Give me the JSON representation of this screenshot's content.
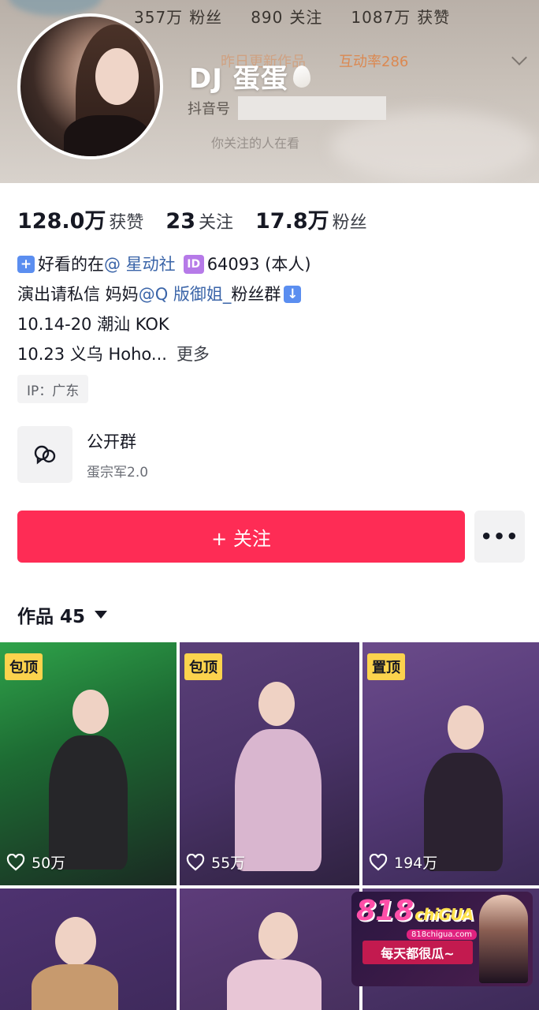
{
  "header": {
    "top_stats": [
      {
        "value": "357万",
        "label": "粉丝"
      },
      {
        "value": "890",
        "label": "关注"
      },
      {
        "value": "1087万",
        "label": "获赞"
      }
    ],
    "faint_line_1": "昨日更新作品",
    "faint_line_2": "互动率286",
    "name": "DJ 蛋蛋",
    "douyin_id_label": "抖音号",
    "faint_line_3": "你关注的人在看"
  },
  "stats": [
    {
      "value": "128.0万",
      "label": "获赞"
    },
    {
      "value": "23",
      "label": "关注"
    },
    {
      "value": "17.8万",
      "label": "粉丝"
    }
  ],
  "bio": {
    "line1_text": "好看的在",
    "line1_mention": "@ 星动社",
    "line1_id_badge": "ID",
    "line1_suffix": "64093 (本人)",
    "line2_text": "演出请私信  妈妈",
    "line2_mention": "@Q 版御姐_",
    "line2_suffix": " 粉丝群",
    "line3": "10.14-20 潮汕 KOK",
    "line4": "10.23 义乌 Hoho...",
    "more": "更多"
  },
  "ip_tag": "IP：广东",
  "group": {
    "title": "公开群",
    "subtitle": "蛋宗军2.0"
  },
  "follow_button": "+ 关注",
  "more_button": "•••",
  "works_tab": "作品 45",
  "tiles": [
    {
      "badge": "包顶",
      "likes": "50万"
    },
    {
      "badge": "包顶",
      "likes": "55万"
    },
    {
      "badge": "置顶",
      "likes": "194万"
    }
  ],
  "ad": {
    "logo": "818",
    "logo_suffix": "chiGUA",
    "domain": "818chigua.com",
    "slogan": "每天都很瓜~"
  },
  "colors": {
    "accent": "#fe2c55",
    "badge": "#fcd34d",
    "mention": "#3a64a8"
  }
}
